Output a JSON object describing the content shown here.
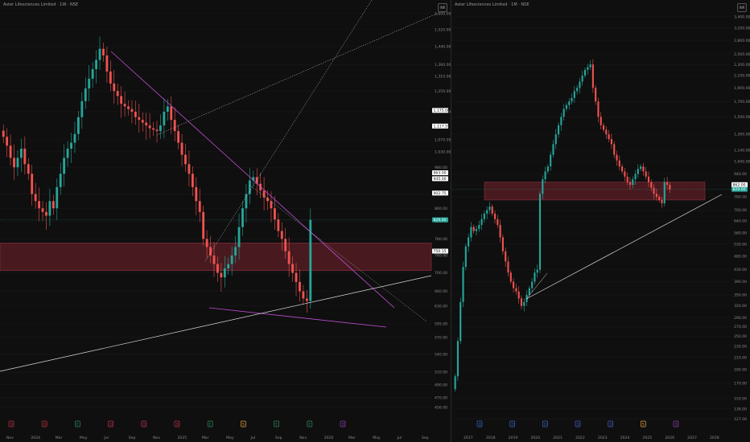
{
  "left_panel": {
    "title": "Aster Lifesciences Limited · 1W · NSE",
    "currency": "INR",
    "chart_data": {
      "type": "candlestick",
      "title": "Aster Lifesciences Limited · 1W · NSE",
      "x_ticks": [
        "Nov",
        "2024",
        "Mar",
        "May",
        "Jul",
        "Sep",
        "Nov",
        "2025",
        "Mar",
        "May",
        "Jul",
        "Sep",
        "Nov",
        "2026",
        "Mar",
        "May",
        "Jul",
        "Sep"
      ],
      "y_ticks": [
        1600,
        1520,
        1440,
        1360,
        1310,
        1250,
        1170,
        1070,
        1030,
        980,
        900,
        860,
        825,
        780,
        740,
        700,
        660,
        630,
        595,
        570,
        540,
        510,
        490,
        470,
        456
      ],
      "y_range": [
        450,
        1620
      ],
      "scale": "log",
      "last_price": 829.0,
      "price_labels": [
        {
          "value": "1,175.00",
          "style": "box"
        },
        {
          "value": "1,117.55",
          "style": "box"
        },
        {
          "value": "963.00",
          "style": "box"
        },
        {
          "value": "945.00",
          "style": "box"
        },
        {
          "value": "902.75",
          "style": "box"
        },
        {
          "value": "829.00",
          "style": "accent"
        },
        {
          "value": "750.15",
          "style": "box"
        }
      ],
      "zone": {
        "top": 770,
        "bottom": 705,
        "color": "#5c1f27"
      },
      "series_close": [
        1080,
        1050,
        1010,
        980,
        1010,
        1040,
        990,
        960,
        900,
        880,
        860,
        850,
        840,
        880,
        860,
        920,
        960,
        1010,
        1040,
        1060,
        1090,
        1150,
        1210,
        1260,
        1300,
        1340,
        1380,
        1430,
        1400,
        1330,
        1280,
        1250,
        1230,
        1200,
        1190,
        1180,
        1170,
        1150,
        1140,
        1130,
        1120,
        1110,
        1105,
        1100,
        1120,
        1170,
        1190,
        1140,
        1100,
        1060,
        1020,
        990,
        960,
        920,
        880,
        850,
        780,
        760,
        740,
        720,
        700,
        690,
        710,
        720,
        740,
        760,
        810,
        860,
        900,
        940,
        950,
        930,
        910,
        890,
        880,
        860,
        830,
        800,
        780,
        750,
        720,
        700,
        680,
        660,
        645,
        640,
        829
      ],
      "markers": [
        {
          "label": "D",
          "color": "#c2334a"
        },
        {
          "label": "D",
          "color": "#c2334a"
        },
        {
          "label": "E",
          "color": "#2e8b57"
        },
        {
          "label": "D",
          "color": "#c2334a"
        },
        {
          "label": "D",
          "color": "#c2334a"
        },
        {
          "label": "D",
          "color": "#c2334a"
        },
        {
          "label": "E",
          "color": "#2e8b57"
        },
        {
          "label": "S",
          "color": "#e8a33d"
        },
        {
          "label": "E",
          "color": "#2e8b57"
        },
        {
          "label": "E",
          "color": "#2e8b57"
        },
        {
          "label": "D",
          "color": "#8e3fb0"
        }
      ]
    }
  },
  "right_panel": {
    "title": "Aster Lifesciences Limited · 1M · NSE",
    "currency": "INR",
    "chart_data": {
      "type": "candlestick",
      "title": "Aster Lifesciences Limited · 1M · NSE",
      "x_ticks": [
        "2017",
        "2018",
        "2019",
        "2020",
        "2021",
        "2022",
        "2023",
        "2024",
        "2025",
        "2026",
        "2027",
        "2028"
      ],
      "y_ticks": [
        3400,
        3100,
        2800,
        2500,
        2300,
        2100,
        1900,
        1700,
        1500,
        1300,
        1140,
        1040,
        940,
        860,
        780,
        700,
        640,
        580,
        530,
        480,
        430,
        390,
        350,
        320,
        290,
        270,
        250,
        230,
        210,
        190,
        170,
        150,
        138,
        127
      ],
      "y_range": [
        120,
        3600
      ],
      "scale": "log",
      "last_price": 829.0,
      "price_labels": [
        {
          "value": "829.00",
          "style": "accent"
        },
        {
          "value": "862.00",
          "style": "box"
        }
      ],
      "zone": {
        "top": 880,
        "bottom": 760,
        "color": "#5c1f27"
      },
      "series_close": [
        180,
        240,
        330,
        440,
        520,
        560,
        610,
        590,
        600,
        620,
        650,
        680,
        700,
        720,
        680,
        650,
        620,
        560,
        500,
        460,
        420,
        390,
        370,
        360,
        340,
        320,
        330,
        350,
        370,
        390,
        420,
        430,
        800,
        900,
        960,
        1000,
        1100,
        1200,
        1300,
        1400,
        1500,
        1600,
        1650,
        1700,
        1750,
        1850,
        1900,
        2000,
        2100,
        2200,
        2250,
        2300,
        1900,
        1700,
        1500,
        1400,
        1350,
        1300,
        1250,
        1200,
        1100,
        1050,
        1000,
        960,
        920,
        880,
        860,
        900,
        940,
        980,
        1000,
        960,
        920,
        880,
        840,
        800,
        780,
        760,
        740,
        880,
        860,
        829
      ],
      "markers": [
        {
          "label": "D",
          "color": "#3f63c7"
        },
        {
          "label": "D",
          "color": "#3f63c7"
        },
        {
          "label": "D",
          "color": "#3f63c7"
        },
        {
          "label": "D",
          "color": "#3f63c7"
        },
        {
          "label": "D",
          "color": "#3f63c7"
        },
        {
          "label": "S",
          "color": "#e8a33d"
        },
        {
          "label": "D",
          "color": "#8e3fb0"
        }
      ]
    }
  },
  "colors": {
    "background": "#0f0f0f",
    "up": "#26a69a",
    "down": "#ef5350",
    "trendline": "#c24fd6",
    "support": "#d9d9d9",
    "grid": "#1b1b1b"
  }
}
